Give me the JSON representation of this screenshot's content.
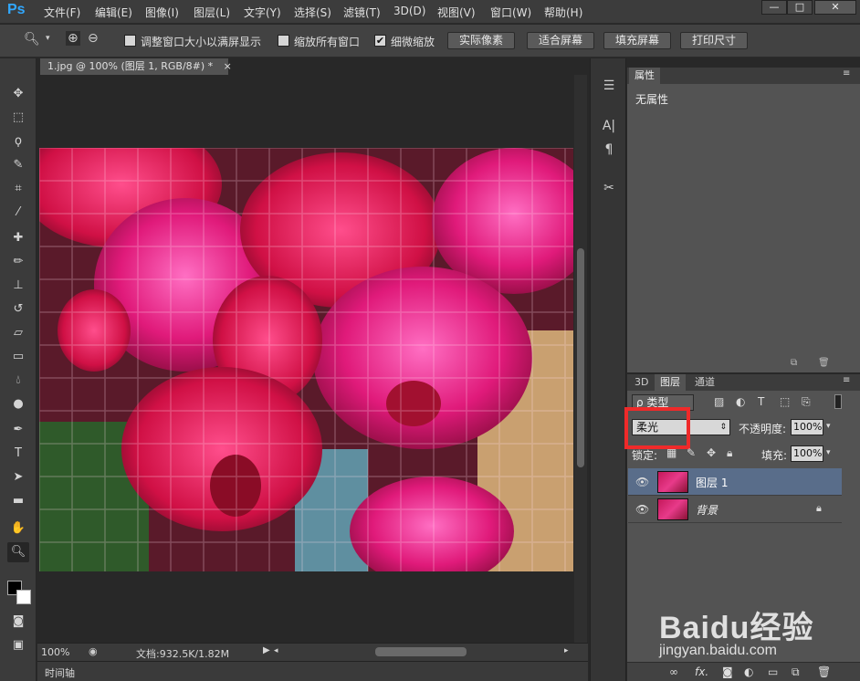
{
  "app": {
    "logo": "Ps"
  },
  "menu": [
    "文件(F)",
    "编辑(E)",
    "图像(I)",
    "图层(L)",
    "文字(Y)",
    "选择(S)",
    "滤镜(T)",
    "3D(D)",
    "视图(V)",
    "窗口(W)",
    "帮助(H)"
  ],
  "window_controls": {
    "minimize": "—",
    "maximize": "□",
    "close": "✕"
  },
  "options": {
    "resize_windows_label": "调整窗口大小以满屏显示",
    "zoom_all_label": "缩放所有窗口",
    "scrubby_zoom_label": "细微缩放",
    "scrubby_zoom_checked": true,
    "btn_actual_pixels": "实际像素",
    "btn_fit_screen": "适合屏幕",
    "btn_fill_screen": "填充屏幕",
    "btn_print_size": "打印尺寸"
  },
  "document": {
    "tab_title": "1.jpg @ 100% (图层 1, RGB/8#) *",
    "close_icon": "×"
  },
  "status": {
    "zoom": "100%",
    "doc_size": "文档:932.5K/1.82M"
  },
  "timeline": {
    "label": "时间轴"
  },
  "properties": {
    "tab": "属性",
    "content": "无属性"
  },
  "layers": {
    "tabs": [
      "3D",
      "图层",
      "通道"
    ],
    "filter_kind": "ρ 类型",
    "blend_mode": "柔光",
    "opacity_label": "不透明度:",
    "opacity_value": "100%",
    "lock_label": "锁定:",
    "fill_label": "填充:",
    "fill_value": "100%",
    "items": [
      {
        "name": "图层 1",
        "selected": true
      },
      {
        "name": "背景",
        "selected": false
      }
    ]
  },
  "bottom_icons": [
    "∞",
    "fx."
  ],
  "watermark": {
    "brand": "Baidu经验",
    "url": "jingyan.baidu.com"
  },
  "colors": {
    "accent_blue": "#31a8ff",
    "highlight_red": "#ef2a2a",
    "panel_gray": "#535353"
  }
}
